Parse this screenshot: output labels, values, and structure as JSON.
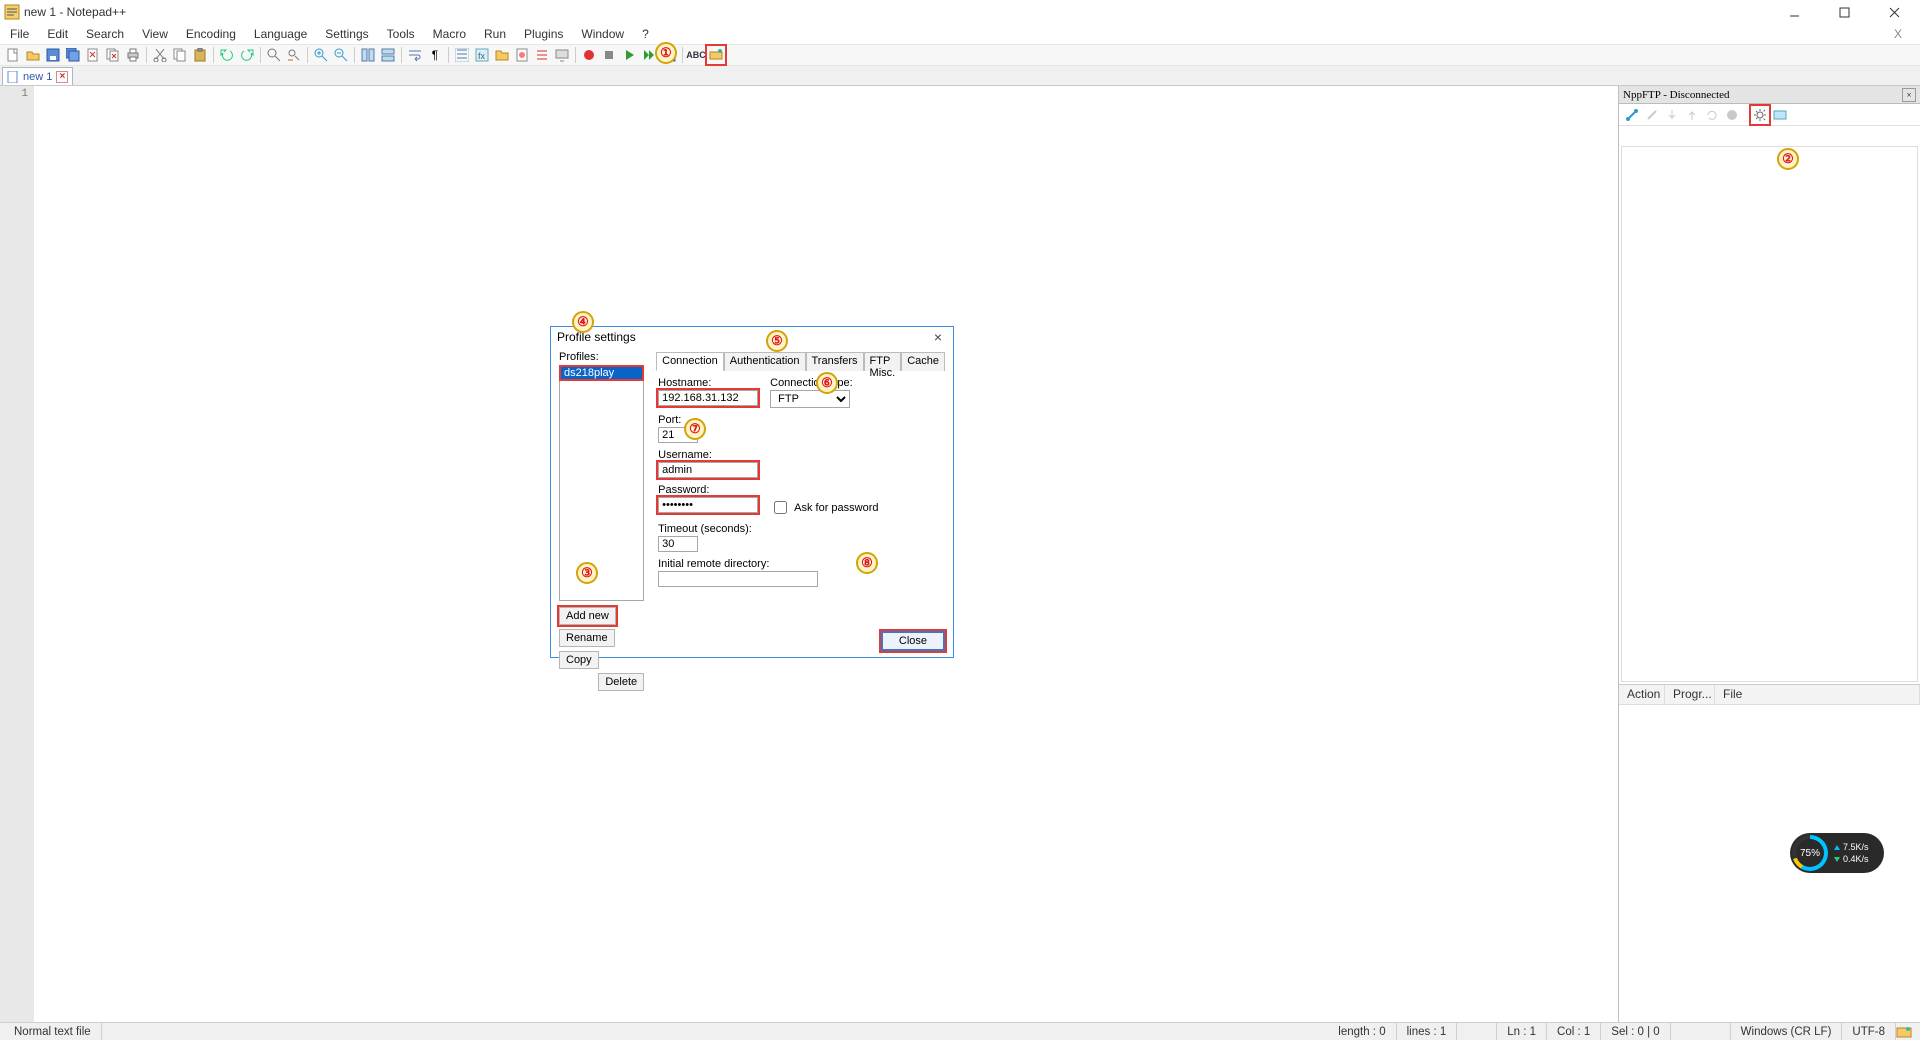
{
  "window": {
    "title": "new 1 - Notepad++"
  },
  "menu": [
    "File",
    "Edit",
    "Search",
    "View",
    "Encoding",
    "Language",
    "Settings",
    "Tools",
    "Macro",
    "Run",
    "Plugins",
    "Window",
    "?"
  ],
  "tabs": {
    "doc1": "new 1"
  },
  "editor": {
    "line1": "1"
  },
  "nppftp": {
    "title": "NppFTP - Disconnected",
    "log_cols": {
      "action": "Action",
      "progr": "Progr...",
      "file": "File"
    }
  },
  "speed": {
    "pct": "75%",
    "up": "7.5K/s",
    "down": "0.4K/s"
  },
  "status": {
    "left": "Normal text file",
    "length": "length : 0",
    "lines": "lines : 1",
    "ln": "Ln : 1",
    "col": "Col : 1",
    "sel": "Sel : 0 | 0",
    "eol": "Windows (CR LF)",
    "enc": "UTF-8"
  },
  "dialog": {
    "title": "Profile settings",
    "profiles_label": "Profiles:",
    "profile_name": "ds218play",
    "btn_add": "Add new",
    "btn_rename": "Rename",
    "btn_copy": "Copy",
    "btn_delete": "Delete",
    "tabs": {
      "conn": "Connection",
      "auth": "Authentication",
      "trans": "Transfers",
      "ftpmisc": "FTP Misc.",
      "cache": "Cache"
    },
    "hostname_label": "Hostname:",
    "hostname": "192.168.31.132",
    "conntype_label": "Connection type:",
    "conntype": "FTP",
    "port_label": "Port:",
    "port": "21",
    "user_label": "Username:",
    "user": "admin",
    "pass_label": "Password:",
    "pass": "••••••••",
    "askpw": "Ask for password",
    "timeout_label": "Timeout (seconds):",
    "timeout": "30",
    "initdir_label": "Initial remote directory:",
    "initdir": "",
    "close": "Close"
  },
  "badges": {
    "b1": "①",
    "b2": "②",
    "b3": "③",
    "b4": "④",
    "b5": "⑤",
    "b6": "⑥",
    "b7": "⑦",
    "b8": "⑧"
  }
}
